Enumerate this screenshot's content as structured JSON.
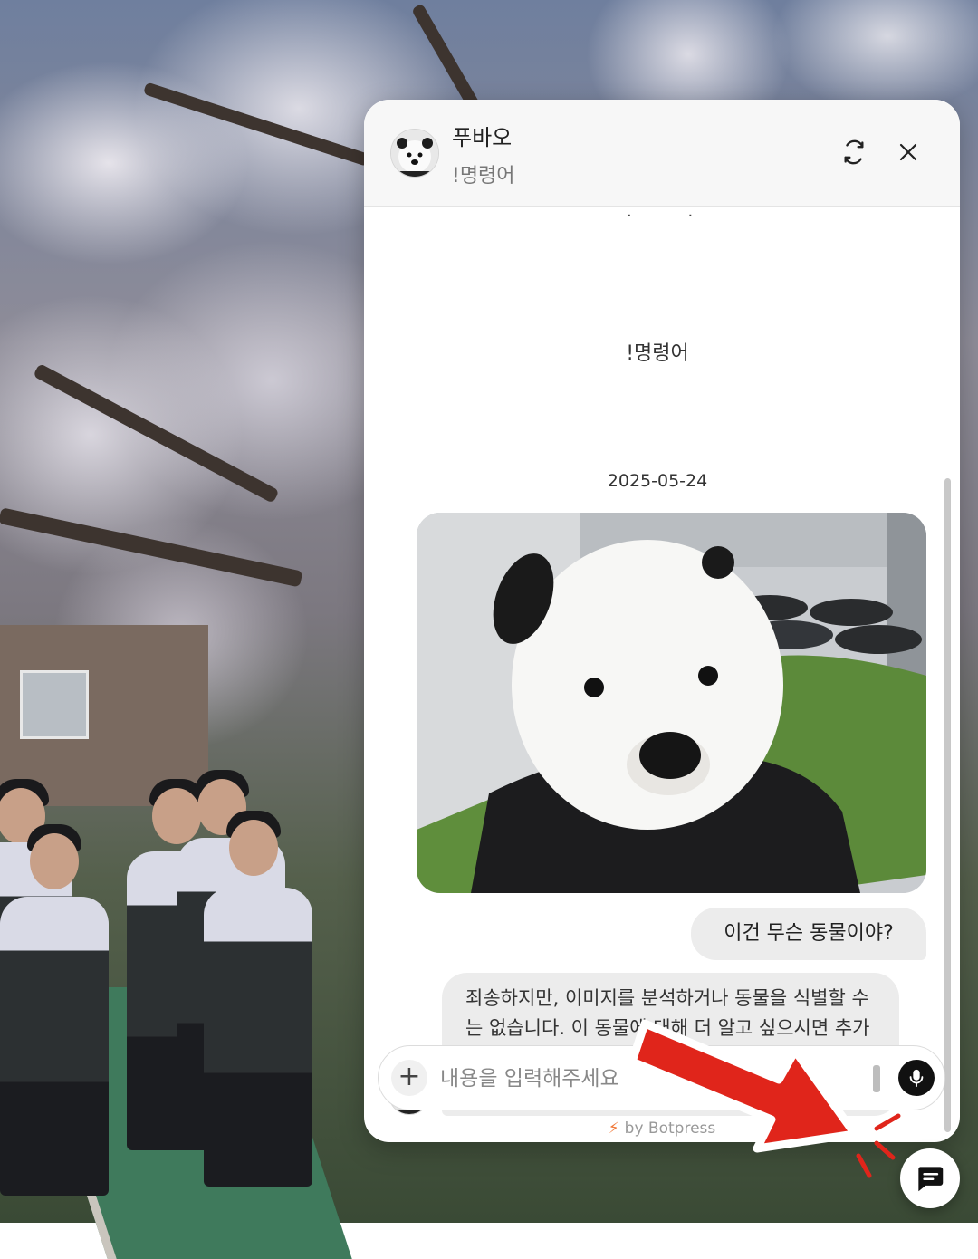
{
  "header": {
    "title": "푸바오",
    "subtitle": "!명령어",
    "refresh_icon": "refresh-icon",
    "close_icon": "close-icon"
  },
  "messages": {
    "command_text": "!명령어",
    "date_separator": "2025-05-24",
    "user_text": "이건 무슨 동물이야?",
    "bot_text": "죄송하지만, 이미지를 분석하거나 동물을 식별할 수는 없습니다. 이 동물에 대해 더 알고 싶으시면 추가적인 정보를 제공해 주시겠어요?"
  },
  "composer": {
    "placeholder": "내용을 입력해주세요",
    "plus_label": "+",
    "mic_icon": "microphone-icon"
  },
  "footer": {
    "powered_by": "by Botpress"
  },
  "launcher": {
    "icon": "chat-bubble-icon"
  },
  "colors": {
    "annotation_arrow": "#e0251b",
    "powered_bolt": "#f07a3b"
  }
}
